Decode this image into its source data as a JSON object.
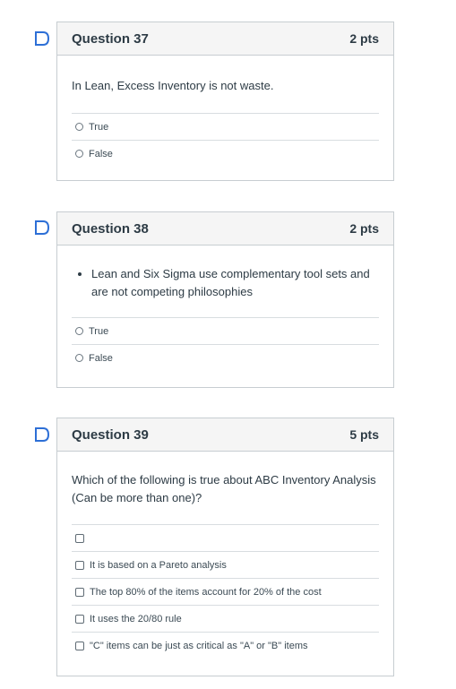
{
  "questions": [
    {
      "title": "Question 37",
      "points": "2 pts",
      "text": "In Lean, Excess Inventory is not waste.",
      "answers": [
        "True",
        "False"
      ]
    },
    {
      "title": "Question 38",
      "points": "2 pts",
      "bullet": "Lean and Six Sigma use complementary tool sets and are not competing philosophies",
      "answers": [
        "True",
        "False"
      ]
    },
    {
      "title": "Question 39",
      "points": "5 pts",
      "text": "Which of the following is true about ABC Inventory Analysis (Can be more than one)?",
      "answers": [
        "",
        "It is based on a Pareto analysis",
        "The top 80% of the items account for 20% of the cost",
        "It uses the 20/80 rule",
        "\"C\" items can be just as critical as \"A\" or \"B\" items"
      ]
    }
  ],
  "colors": {
    "flag": "#2d6fd6",
    "border": "#c7cdd1",
    "header_bg": "#f5f5f5",
    "text": "#2d3b45"
  },
  "icons": {
    "flag": "bookmark-flag-icon",
    "radio": "radio-button-icon",
    "checkbox": "checkbox-icon"
  }
}
